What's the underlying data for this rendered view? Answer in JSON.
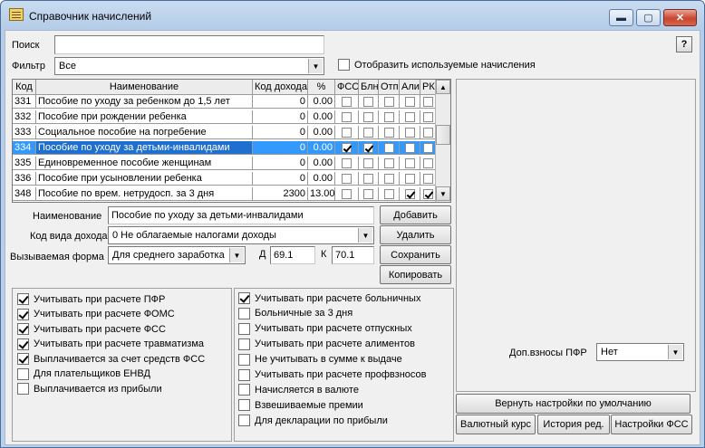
{
  "window": {
    "title": "Справочник начислений",
    "minimize_glyph": "▬",
    "maximize_glyph": "▢",
    "close_glyph": "✕"
  },
  "search": {
    "label": "Поиск",
    "value": ""
  },
  "filter": {
    "label": "Фильтр",
    "value": "Все"
  },
  "show_used": {
    "label": "Отобразить используемые начисления",
    "checked": false
  },
  "help_label": "?",
  "grid": {
    "columns": [
      "Код",
      "Наименование",
      "Код дохода",
      "%",
      "ФСС",
      "Блн",
      "Отп",
      "Али",
      "РК"
    ],
    "rows": [
      {
        "code": "331",
        "name": "Пособие по уходу за ребенком до 1,5 лет",
        "income_code": "0",
        "pct": "0.00",
        "fss": false,
        "bln": false,
        "otp": false,
        "ali": false,
        "rk": false,
        "selected": false
      },
      {
        "code": "332",
        "name": "Пособие при рождении ребенка",
        "income_code": "0",
        "pct": "0.00",
        "fss": false,
        "bln": false,
        "otp": false,
        "ali": false,
        "rk": false,
        "selected": false
      },
      {
        "code": "333",
        "name": "Социальное пособие на погребение",
        "income_code": "0",
        "pct": "0.00",
        "fss": false,
        "bln": false,
        "otp": false,
        "ali": false,
        "rk": false,
        "selected": false
      },
      {
        "code": "334",
        "name": "Пособие по уходу за детьми-инвалидами",
        "income_code": "0",
        "pct": "0.00",
        "fss": true,
        "bln": true,
        "otp": false,
        "ali": false,
        "rk": false,
        "selected": true
      },
      {
        "code": "335",
        "name": "Единовременное пособие женщинам",
        "income_code": "0",
        "pct": "0.00",
        "fss": false,
        "bln": false,
        "otp": false,
        "ali": false,
        "rk": false,
        "selected": false
      },
      {
        "code": "336",
        "name": "Пособие при усыновлении ребенка",
        "income_code": "0",
        "pct": "0.00",
        "fss": false,
        "bln": false,
        "otp": false,
        "ali": false,
        "rk": false,
        "selected": false
      },
      {
        "code": "348",
        "name": "Пособие по врем. нетрудосп. за  3 дня",
        "income_code": "2300",
        "pct": "13.00",
        "fss": false,
        "bln": false,
        "otp": false,
        "ali": true,
        "rk": true,
        "selected": false
      }
    ]
  },
  "form": {
    "name_label": "Наименование",
    "name_value": "Пособие по уходу за детьми-инвалидами",
    "income_type_label": "Код вида дохода",
    "income_type_value": "0 Не облагаемые налогами доходы",
    "called_form_label": "Вызываемая форма",
    "called_form_value": "Для среднего заработка",
    "d_label": "Д",
    "d_value": "69.1",
    "k_label": "К",
    "k_value": "70.1"
  },
  "actions": {
    "add": "Добавить",
    "delete": "Удалить",
    "save": "Сохранить",
    "copy": "Копировать"
  },
  "left_checks": [
    {
      "label": "Учитывать при расчете ПФР",
      "checked": true
    },
    {
      "label": "Учитывать при расчете ФОМС",
      "checked": true
    },
    {
      "label": "Учитывать при расчете ФСС",
      "checked": true
    },
    {
      "label": "Учитывать при расчете травматизма",
      "checked": true
    },
    {
      "label": "Выплачивается за счет средств ФСС",
      "checked": true
    },
    {
      "label": "Для плательщиков ЕНВД",
      "checked": false
    },
    {
      "label": "Выплачивается из прибыли",
      "checked": false
    }
  ],
  "right_checks": [
    {
      "label": "Учитывать при расчете больничных",
      "checked": true
    },
    {
      "label": "Больничные за 3 дня",
      "checked": false
    },
    {
      "label": "Учитывать при расчете отпускных",
      "checked": false
    },
    {
      "label": "Учитывать при расчете алиментов",
      "checked": false
    },
    {
      "label": "Не учитывать в сумме к выдаче",
      "checked": false
    },
    {
      "label": "Учитывать при расчете профвзносов",
      "checked": false
    },
    {
      "label": "Начисляется в валюте",
      "checked": false
    },
    {
      "label": "Взвешиваемые премии",
      "checked": false
    },
    {
      "label": "Для декларации по прибыли",
      "checked": false
    }
  ],
  "pfr_extra": {
    "label": "Доп.взносы ПФР",
    "value": "Нет"
  },
  "bottom": {
    "reset": "Вернуть настройки по умолчанию",
    "currency": "Валютный курс",
    "history": "История ред.",
    "fss_settings": "Настройки ФСС"
  }
}
